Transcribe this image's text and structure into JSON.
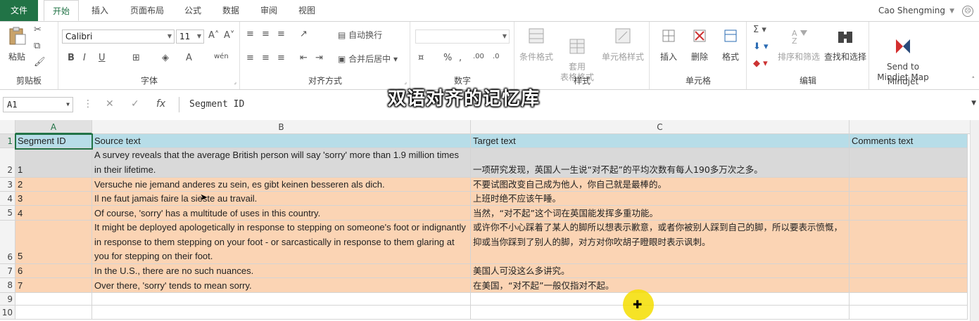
{
  "tabs": {
    "file": "文件",
    "home": "开始",
    "insert": "插入",
    "page_layout": "页面布局",
    "formulas": "公式",
    "data": "数据",
    "review": "审阅",
    "view": "视图"
  },
  "user": {
    "name": "Cao Shengming"
  },
  "ribbon": {
    "clipboard": {
      "label": "剪贴板",
      "paste": "粘贴"
    },
    "font": {
      "label": "字体",
      "font_name": "Calibri",
      "font_size": "11",
      "bold": "B",
      "italic": "I",
      "underline": "U"
    },
    "alignment": {
      "label": "对齐方式",
      "wrap_text": "自动换行",
      "merge_center": "合并后居中"
    },
    "number": {
      "label": "数字",
      "percent": "%"
    },
    "styles": {
      "label": "样式",
      "conditional": "条件格式",
      "table_format": "套用\n表格格式",
      "cell_styles": "单元格样式"
    },
    "cells": {
      "label": "单元格",
      "insert": "插入",
      "delete": "删除",
      "format": "格式"
    },
    "editing": {
      "label": "编辑",
      "sort_filter": "排序和筛选",
      "find_select": "查找和选择"
    },
    "mindjet": {
      "label": "Mindjet",
      "send": "Send to\nMindjet Map"
    }
  },
  "overlay_title": "双语对齐的记忆库",
  "formula_bar": {
    "name_box": "A1",
    "fx": "fx",
    "content": "Segment ID"
  },
  "sheet": {
    "columns": [
      "A",
      "B",
      "C"
    ],
    "header": [
      "Segment ID",
      "Source text",
      "Target text",
      "Comments text"
    ],
    "rows": [
      {
        "n": "1",
        "id": "1",
        "source": "A survey reveals that the average British person will say 'sorry' more than 1.9 million times in their lifetime.",
        "target": "一项研究发现，英国人一生说“对不起”的平均次数有每人190多万次之多。"
      },
      {
        "n": "2",
        "id": "2",
        "source": "Versuche nie jemand anderes zu sein, es gibt keinen besseren als dich.",
        "target": "不要试图改变自己成为他人，你自己就是最棒的。"
      },
      {
        "n": "3",
        "id": "3",
        "source": "Il ne faut jamais faire la sieste au travail.",
        "target": "上班时绝不应该午睡。"
      },
      {
        "n": "4",
        "id": "4",
        "source": "Of course, 'sorry' has a multitude of uses in this country.",
        "target": "当然，“对不起”这个词在英国能发挥多重功能。"
      },
      {
        "n": "5",
        "id": "5",
        "source": "It might be deployed apologetically in response to stepping on someone's foot or indignantly in response to them stepping on your foot - or sarcastically in response to them glaring at you for stepping on their foot.",
        "target": "或许你不小心踩着了某人的脚所以想表示歉意，或者你被别人踩到自己的脚，所以要表示愤慨，抑或当你踩到了别人的脚，对方对你吹胡子瞪眼时表示讽刺。"
      },
      {
        "n": "6",
        "id": "6",
        "source": "In the U.S., there are no such nuances.",
        "target": "美国人可没这么多讲究。"
      },
      {
        "n": "7",
        "id": "7",
        "source": "Over there, 'sorry' tends to mean sorry.",
        "target": "在美国，“对不起”一般仅指对不起。"
      }
    ],
    "row_numbers": [
      "1",
      "2",
      "3",
      "4",
      "5",
      "6",
      "7",
      "8",
      "9",
      "10"
    ]
  },
  "colors": {
    "header_fill": "#b7dde8",
    "row1_fill": "#d9d9d9",
    "row_fill": "#fbd4b4",
    "accent": "#217346"
  }
}
